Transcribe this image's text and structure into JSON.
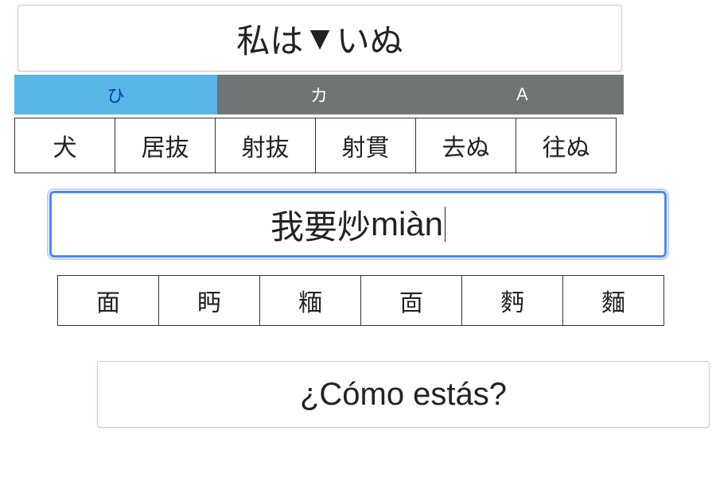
{
  "japanese": {
    "input_before": "私は",
    "caret_glyph": "▼",
    "input_after": "いぬ",
    "modes": [
      {
        "label": "ひ",
        "active": true
      },
      {
        "label": "カ",
        "active": false
      },
      {
        "label": "A",
        "active": false
      }
    ],
    "candidates": [
      "犬",
      "居抜",
      "射抜",
      "射貫",
      "去ぬ",
      "往ぬ"
    ]
  },
  "chinese": {
    "input_committed": "我要炒",
    "input_composing": "miàn",
    "candidates": [
      "面",
      "眄",
      "糆",
      "靣",
      "麪",
      "麵"
    ]
  },
  "spanish": {
    "input_text": "¿Cómo estás?"
  }
}
